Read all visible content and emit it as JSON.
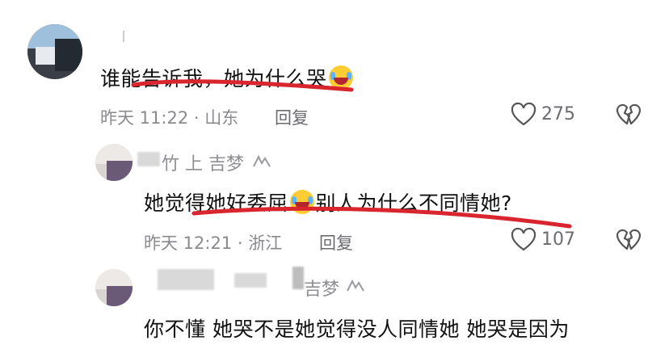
{
  "comments": [
    {
      "name": "",
      "text_before_emoji": "谁能告诉我，她为什么哭",
      "text_after_emoji": "",
      "time": "昨天 11:22",
      "location": "山东",
      "reply_label": "回复",
      "like_count": "275"
    },
    {
      "name": "竹 上 吉梦",
      "text_before_emoji": "她觉得她好委屈",
      "text_after_emoji": "别人为什么不同情她?",
      "time": "昨天 12:21",
      "location": "浙江",
      "reply_label": "回复",
      "like_count": "107"
    },
    {
      "name": "吉梦",
      "text_before_emoji": "你不懂 她哭不是她觉得没人同情她  她哭是因为",
      "text_after_emoji": ""
    }
  ],
  "separator": "·",
  "icons": {
    "like": "heart-outline-icon",
    "dislike": "broken-heart-icon",
    "emoji": "laughing-crying-emoji-icon",
    "author_badge": "author-badge-icon"
  },
  "colors": {
    "underline": "#d9262e",
    "meta_text": "#8a8a8e"
  }
}
